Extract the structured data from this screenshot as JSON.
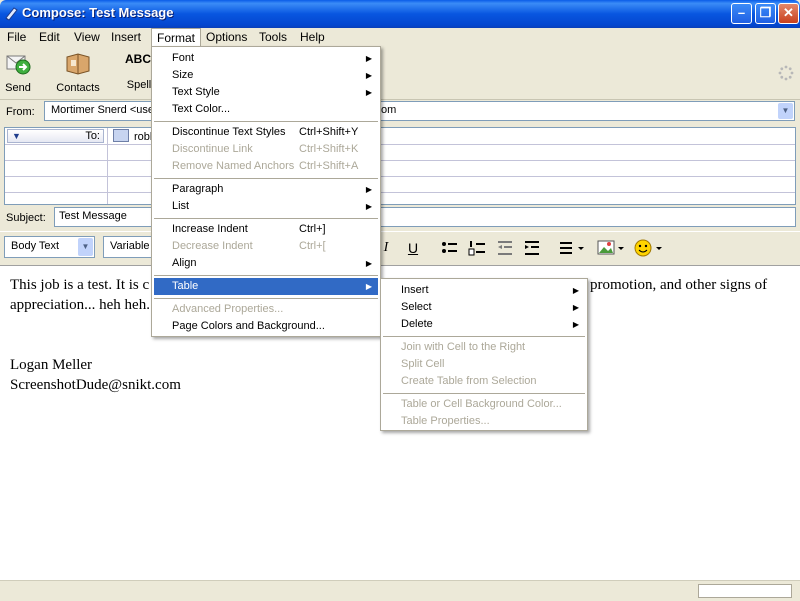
{
  "window": {
    "title": "Compose: Test Message",
    "min_symbol": "–",
    "max_symbol": "❐",
    "close_symbol": "✕"
  },
  "menubar": [
    "File",
    "Edit",
    "View",
    "Insert",
    "Format",
    "Options",
    "Tools",
    "Help"
  ],
  "toolbar": {
    "send": "Send",
    "contacts": "Contacts",
    "spell": "Spell",
    "spell_icon_text": "ABC"
  },
  "header": {
    "from_label": "From:",
    "from_value": "Mortimer Snerd <use",
    "from_tail": "om",
    "to_label": "To:",
    "to_value": "robb",
    "subject_label": "Subject:",
    "subject_value": "Test Message"
  },
  "format_toolbar": {
    "paragraph_style": "Body Text",
    "font": "Variable",
    "italic": "I",
    "underline": "U"
  },
  "body": {
    "line1_left": "This job is a test.  It is c",
    "line1_right": "promotion, and other signs of",
    "line2": "appreciation... heh heh.",
    "sig_name": "Logan Meller",
    "sig_email": "ScreenshotDude@snikt.com"
  },
  "format_menu": {
    "items": [
      {
        "label": "Font",
        "submenu": true
      },
      {
        "label": "Size",
        "submenu": true
      },
      {
        "label": "Text Style",
        "submenu": true
      },
      {
        "label": "Text Color..."
      },
      {
        "label": "Discontinue Text Styles",
        "shortcut": "Ctrl+Shift+Y"
      },
      {
        "label": "Discontinue Link",
        "shortcut": "Ctrl+Shift+K",
        "disabled": true
      },
      {
        "label": "Remove Named Anchors",
        "shortcut": "Ctrl+Shift+A",
        "disabled": true
      },
      {
        "label": "Paragraph",
        "submenu": true
      },
      {
        "label": "List",
        "submenu": true
      },
      {
        "label": "Increase Indent",
        "shortcut": "Ctrl+]"
      },
      {
        "label": "Decrease Indent",
        "shortcut": "Ctrl+[",
        "disabled": true
      },
      {
        "label": "Align",
        "submenu": true
      },
      {
        "label": "Table",
        "submenu": true,
        "selected": true
      },
      {
        "label": "Advanced Properties...",
        "disabled": true
      },
      {
        "label": "Page Colors and Background..."
      }
    ]
  },
  "table_menu": {
    "items": [
      {
        "label": "Insert",
        "submenu": true
      },
      {
        "label": "Select",
        "submenu": true
      },
      {
        "label": "Delete",
        "submenu": true
      },
      {
        "label": "Join with Cell to the Right",
        "disabled": true
      },
      {
        "label": "Split Cell",
        "disabled": true
      },
      {
        "label": "Create Table from Selection",
        "disabled": true
      },
      {
        "label": "Table or Cell Background Color...",
        "disabled": true
      },
      {
        "label": "Table Properties...",
        "disabled": true
      }
    ]
  },
  "submenu_arrow": "▶",
  "dropdown_arrow": "▼"
}
